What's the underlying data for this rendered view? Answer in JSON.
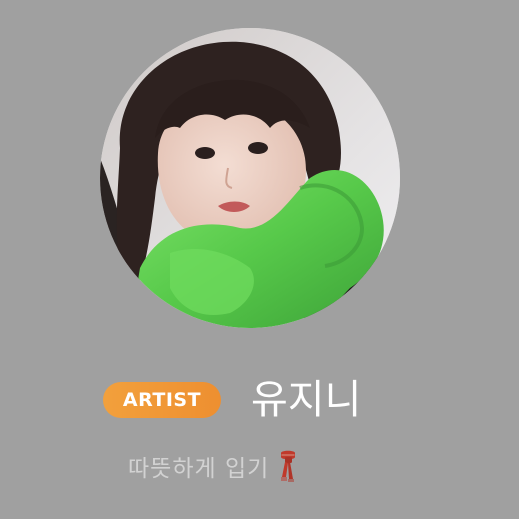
{
  "profile": {
    "role_badge": "ARTIST",
    "name": "유지니",
    "status": "따뜻하게 입기",
    "status_icon": "scarf-icon",
    "avatar_icon": "profile-photo"
  },
  "colors": {
    "background": "#a0a0a0",
    "badge_start": "#f2a03c",
    "badge_end": "#ee8f30",
    "name_text": "#ffffff",
    "status_text": "#d2d2d2",
    "scarf": "#c0392b"
  }
}
